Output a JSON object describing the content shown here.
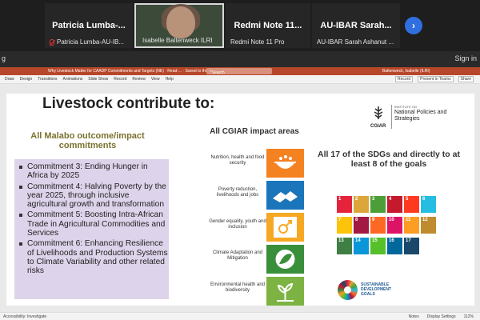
{
  "meeting": {
    "participants": [
      {
        "name": "Patricia  Lumba-...",
        "sub": "Patricia Lumba-AU-IB...",
        "muted": true
      },
      {
        "name": "",
        "sub": "Isabelle Baltenweck ILRI",
        "muted": false
      },
      {
        "name": "Redmi Note 11...",
        "sub": "Redmi Note 11 Pro",
        "muted": false
      },
      {
        "name": "AU-IBAR Sarah...",
        "sub": "AU-IBAR Sarah Ashanut ...",
        "muted": false
      }
    ],
    "next_icon": "chevron-right-icon",
    "left_text": "g",
    "sign_in": "Sign in"
  },
  "ppt": {
    "title": "Why Livestock Matter for CAADP Commitments and Targets (NE) · Read-... · Saved to this PC",
    "search_placeholder": "Search",
    "user": "Baltenweck, Isabelle (ILRI)",
    "tabs": [
      "Draw",
      "Design",
      "Transitions",
      "Animations",
      "Slide Show",
      "Record",
      "Review",
      "View",
      "Help"
    ],
    "actions": [
      "Record",
      "Present in Teams",
      "Share"
    ],
    "status_left": "Accessibility: Investigate",
    "status_right": [
      "Notes",
      "Display Settings",
      "112%"
    ]
  },
  "slide": {
    "title": "Livestock contribute to:",
    "logo": {
      "org": "CGIAR",
      "inst": "INSTITUTE ON",
      "name": "National Policies and Strategies"
    },
    "col1": {
      "heading": "All Malabo outcome/impact commitments",
      "items": [
        "Commitment 3: Ending Hunger in Africa by 2025",
        "Commitment 4: Halving Poverty by the year 2025, through inclusive agricultural growth and transformation",
        "Commitment 5: Boosting Intra-African Trade in Agricultural Commodities and Services",
        "Commitment 6: Enhancing Resilience of Livelihoods and Production Systems to Climate Variability and other related risks"
      ]
    },
    "col2": {
      "heading": "All CGIAR impact areas",
      "areas": [
        {
          "label": "Nutrition, health and food security",
          "color": "#f58220",
          "icon": "food-bowl-icon"
        },
        {
          "label": "Poverty reduction, livelihoods and jobs",
          "color": "#1b75bb",
          "icon": "handshake-icon"
        },
        {
          "label": "Gender equality, youth and inclusion",
          "color": "#f7a823",
          "icon": "gender-icon"
        },
        {
          "label": "Climate Adaptation and Mitigation",
          "color": "#3a8f3a",
          "icon": "leaf-globe-icon"
        },
        {
          "label": "Environmental health and biodiversity",
          "color": "#7cb342",
          "icon": "plant-icon"
        }
      ]
    },
    "col3": {
      "heading": "All 17 of the SDGs and directly to at least 8 of the goals",
      "sdgs": [
        {
          "n": "1",
          "color": "#e5243b"
        },
        {
          "n": "2",
          "color": "#dda63a"
        },
        {
          "n": "3",
          "color": "#4c9f38"
        },
        {
          "n": "4",
          "color": "#c5192d"
        },
        {
          "n": "5",
          "color": "#ff3a21"
        },
        {
          "n": "6",
          "color": "#26bde2"
        },
        {
          "n": "7",
          "color": "#fcc30b"
        },
        {
          "n": "8",
          "color": "#a21942"
        },
        {
          "n": "9",
          "color": "#fd6925"
        },
        {
          "n": "10",
          "color": "#dd1367"
        },
        {
          "n": "11",
          "color": "#fd9d24"
        },
        {
          "n": "12",
          "color": "#bf8b2e"
        },
        {
          "n": "13",
          "color": "#3f7e44"
        },
        {
          "n": "14",
          "color": "#0a97d9"
        },
        {
          "n": "15",
          "color": "#56c02b"
        },
        {
          "n": "16",
          "color": "#00689d"
        },
        {
          "n": "17",
          "color": "#19486a"
        }
      ],
      "goals_text": "SUSTAINABLE DEVELOPMENT GOALS"
    }
  }
}
